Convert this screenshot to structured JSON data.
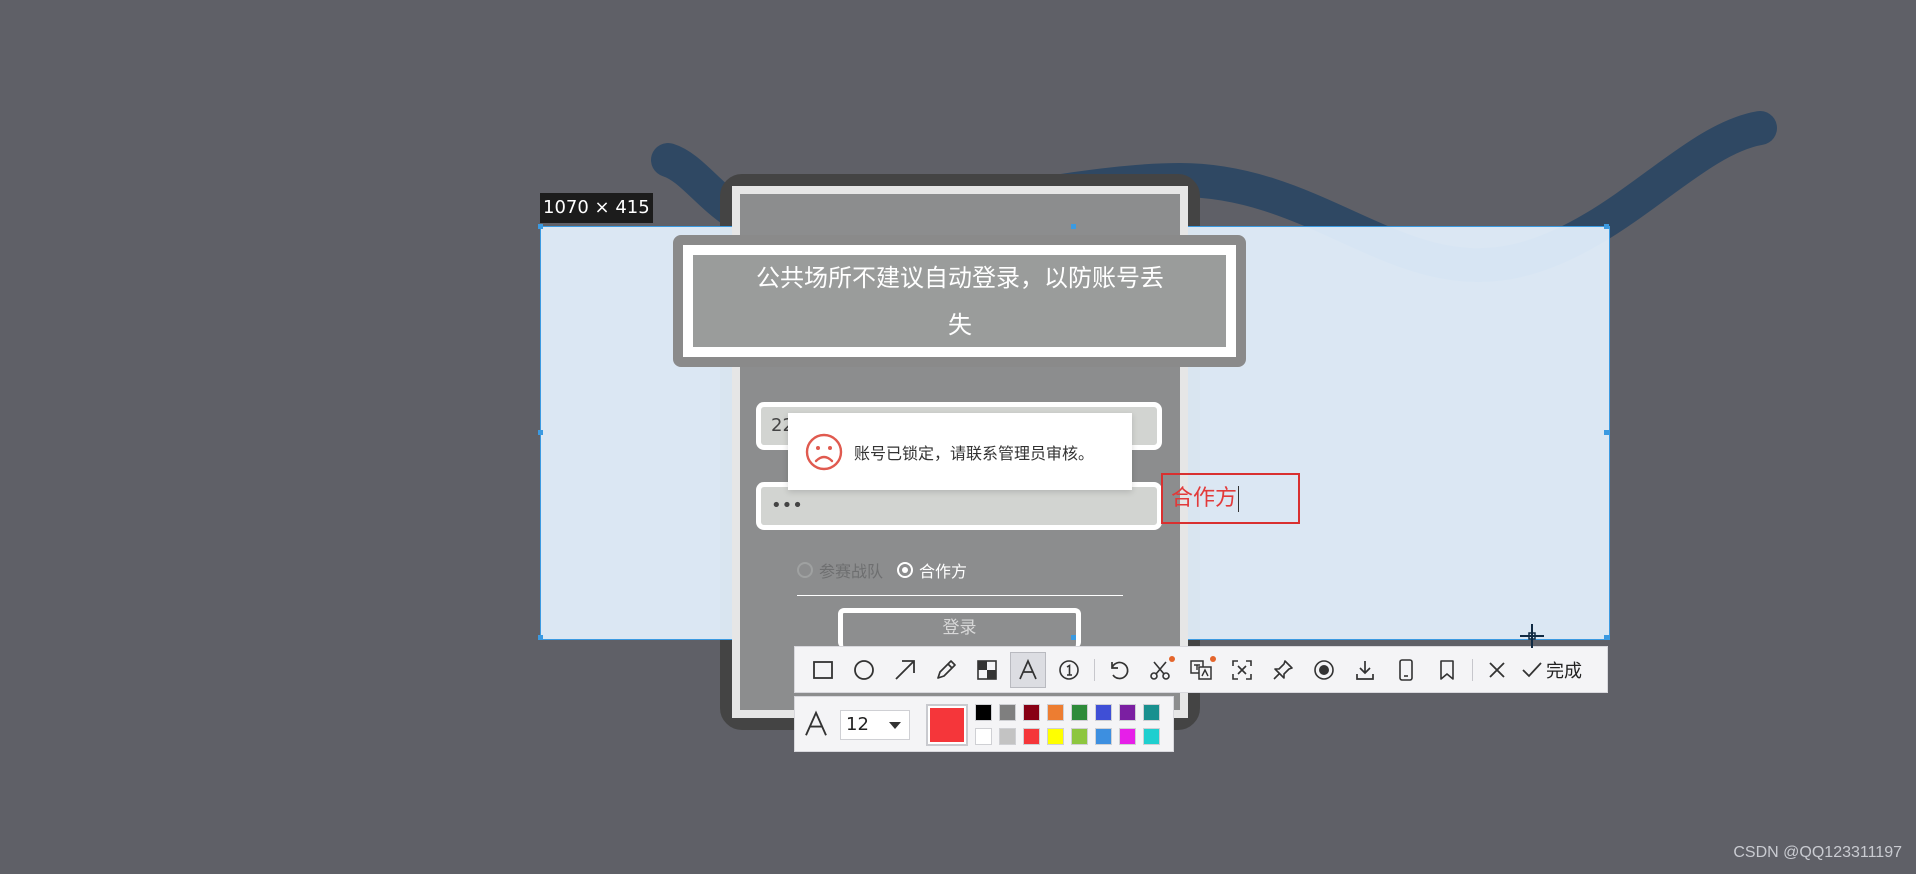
{
  "selection": {
    "size_label": "1070 × 415"
  },
  "app": {
    "notice": "公共场所不建议自动登录，以防账号丢失",
    "username_value": "22",
    "password_value": "•••",
    "role_options": [
      {
        "label": "参赛战队",
        "selected": false
      },
      {
        "label": "合作方",
        "selected": true
      }
    ],
    "login_label": "登录"
  },
  "toast": {
    "message": "账号已锁定，请联系管理员审核。",
    "icon": "sad-face-icon"
  },
  "annotation": {
    "text": "合作方",
    "color": "#e23a3a"
  },
  "toolbar": {
    "tools": [
      {
        "name": "rectangle-tool",
        "icon": "rectangle-icon"
      },
      {
        "name": "ellipse-tool",
        "icon": "ellipse-icon"
      },
      {
        "name": "arrow-tool",
        "icon": "arrow-icon"
      },
      {
        "name": "pencil-tool",
        "icon": "pencil-icon"
      },
      {
        "name": "mosaic-tool",
        "icon": "mosaic-icon"
      },
      {
        "name": "text-tool",
        "icon": "text-icon",
        "active": true
      },
      {
        "name": "serial-number-tool",
        "icon": "number-circle-icon"
      },
      {
        "name": "undo-tool",
        "icon": "undo-icon",
        "separator_before": true
      },
      {
        "name": "cutout-tool",
        "icon": "scissors-icon",
        "badge": true
      },
      {
        "name": "translate-tool",
        "icon": "translate-icon",
        "badge": true
      },
      {
        "name": "ocr-tool",
        "icon": "ocr-icon"
      },
      {
        "name": "pin-tool",
        "icon": "pin-icon"
      },
      {
        "name": "record-tool",
        "icon": "record-icon"
      },
      {
        "name": "save-tool",
        "icon": "download-icon"
      },
      {
        "name": "send-to-phone-tool",
        "icon": "phone-icon"
      },
      {
        "name": "bookmark-tool",
        "icon": "bookmark-icon"
      },
      {
        "name": "cancel-tool",
        "icon": "close-icon",
        "separator_before": true
      }
    ],
    "done_label": "完成"
  },
  "text_props": {
    "font_size": "12",
    "current_color": "#f5363a",
    "palette": [
      "#000000",
      "#7f7f7f",
      "#880015",
      "#ed7d31",
      "#2e8b3a",
      "#3f4fd6",
      "#7b1fa2",
      "#19908f",
      "#ffffff",
      "#c3c3c3",
      "#f5363a",
      "#ffff00",
      "#8dc63f",
      "#3d8fe0",
      "#e61fe8",
      "#1fcfcf"
    ]
  },
  "watermark": "CSDN @QQ123311197"
}
